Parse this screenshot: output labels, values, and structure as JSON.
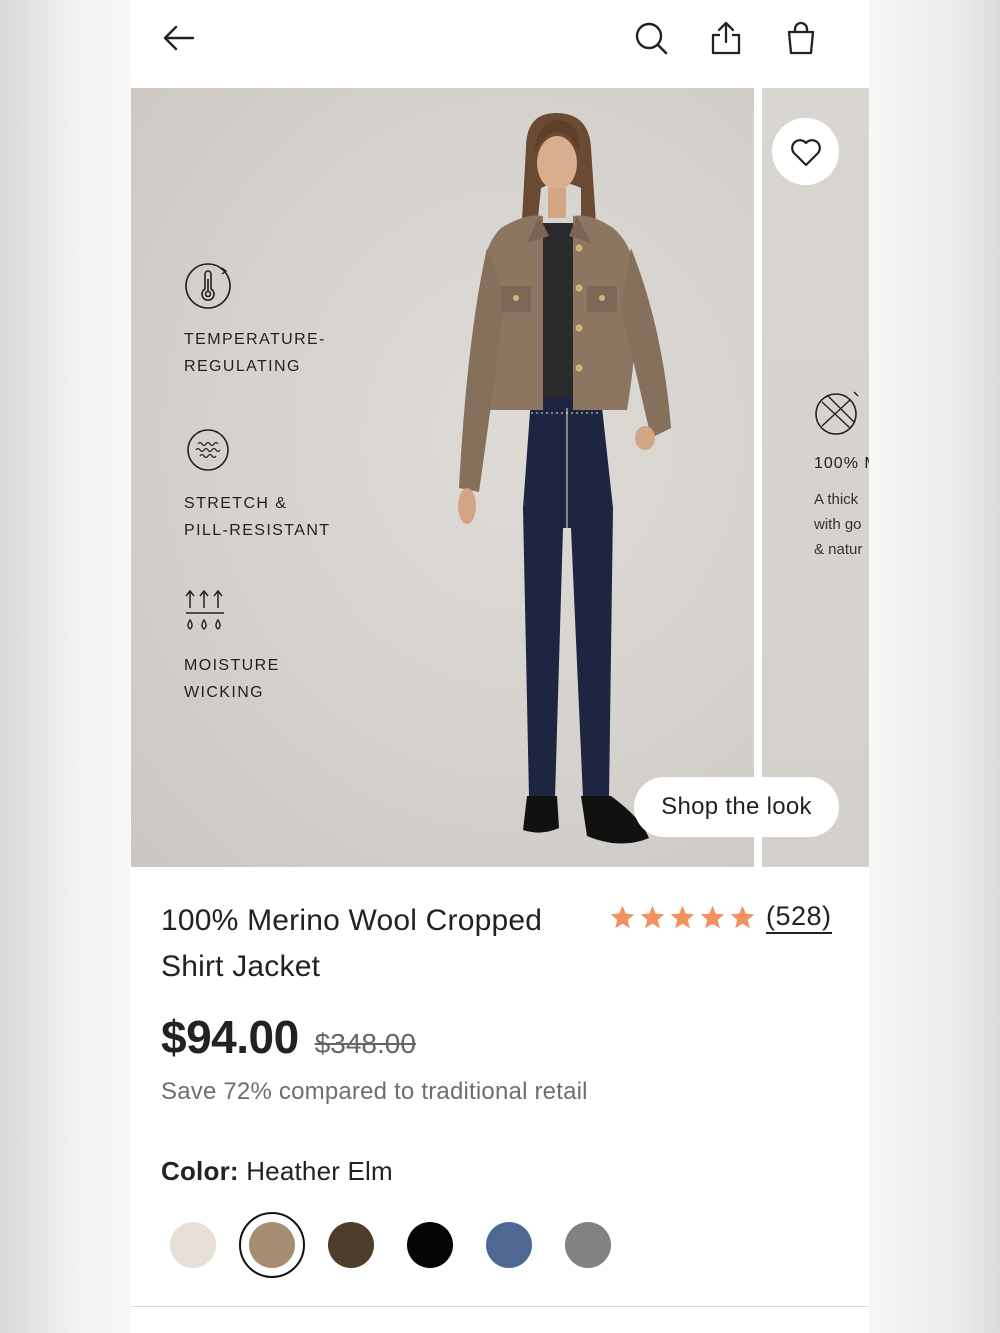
{
  "header": {
    "back_icon": "arrow-left-icon",
    "search_icon": "search-icon",
    "share_icon": "share-icon",
    "bag_icon": "shopping-bag-icon"
  },
  "gallery": {
    "features": [
      {
        "icon": "thermometer-icon",
        "line1": "TEMPERATURE-",
        "line2": "REGULATING"
      },
      {
        "icon": "stretch-icon",
        "line1": "STRETCH &",
        "line2": "PILL-RESISTANT"
      },
      {
        "icon": "moisture-icon",
        "line1": "MOISTURE",
        "line2": "WICKING"
      }
    ],
    "next_slide": {
      "title": "100% M",
      "desc": "A thick\nwith go\n& natur"
    },
    "shop_the_look": "Shop the look",
    "favorite_icon": "heart-icon"
  },
  "product": {
    "title": "100% Merino Wool Cropped Shirt Jacket",
    "rating_stars": 5,
    "rating_count": "(528)",
    "price": "$94.00",
    "original_price": "$348.00",
    "savings": "Save 72% compared to traditional retail",
    "color_label": "Color:",
    "color_value": "Heather Elm",
    "swatches": [
      {
        "color": "#e6e0d8",
        "selected": false
      },
      {
        "color": "#a58d74",
        "selected": true
      },
      {
        "color": "#4e3d2a",
        "selected": false
      },
      {
        "color": "#050505",
        "selected": false
      },
      {
        "color": "#4f6893",
        "selected": false
      },
      {
        "color": "#828282",
        "selected": false
      }
    ]
  },
  "colors": {
    "star": "#f3925f",
    "text": "#222222",
    "muted": "#6e6e6e"
  }
}
